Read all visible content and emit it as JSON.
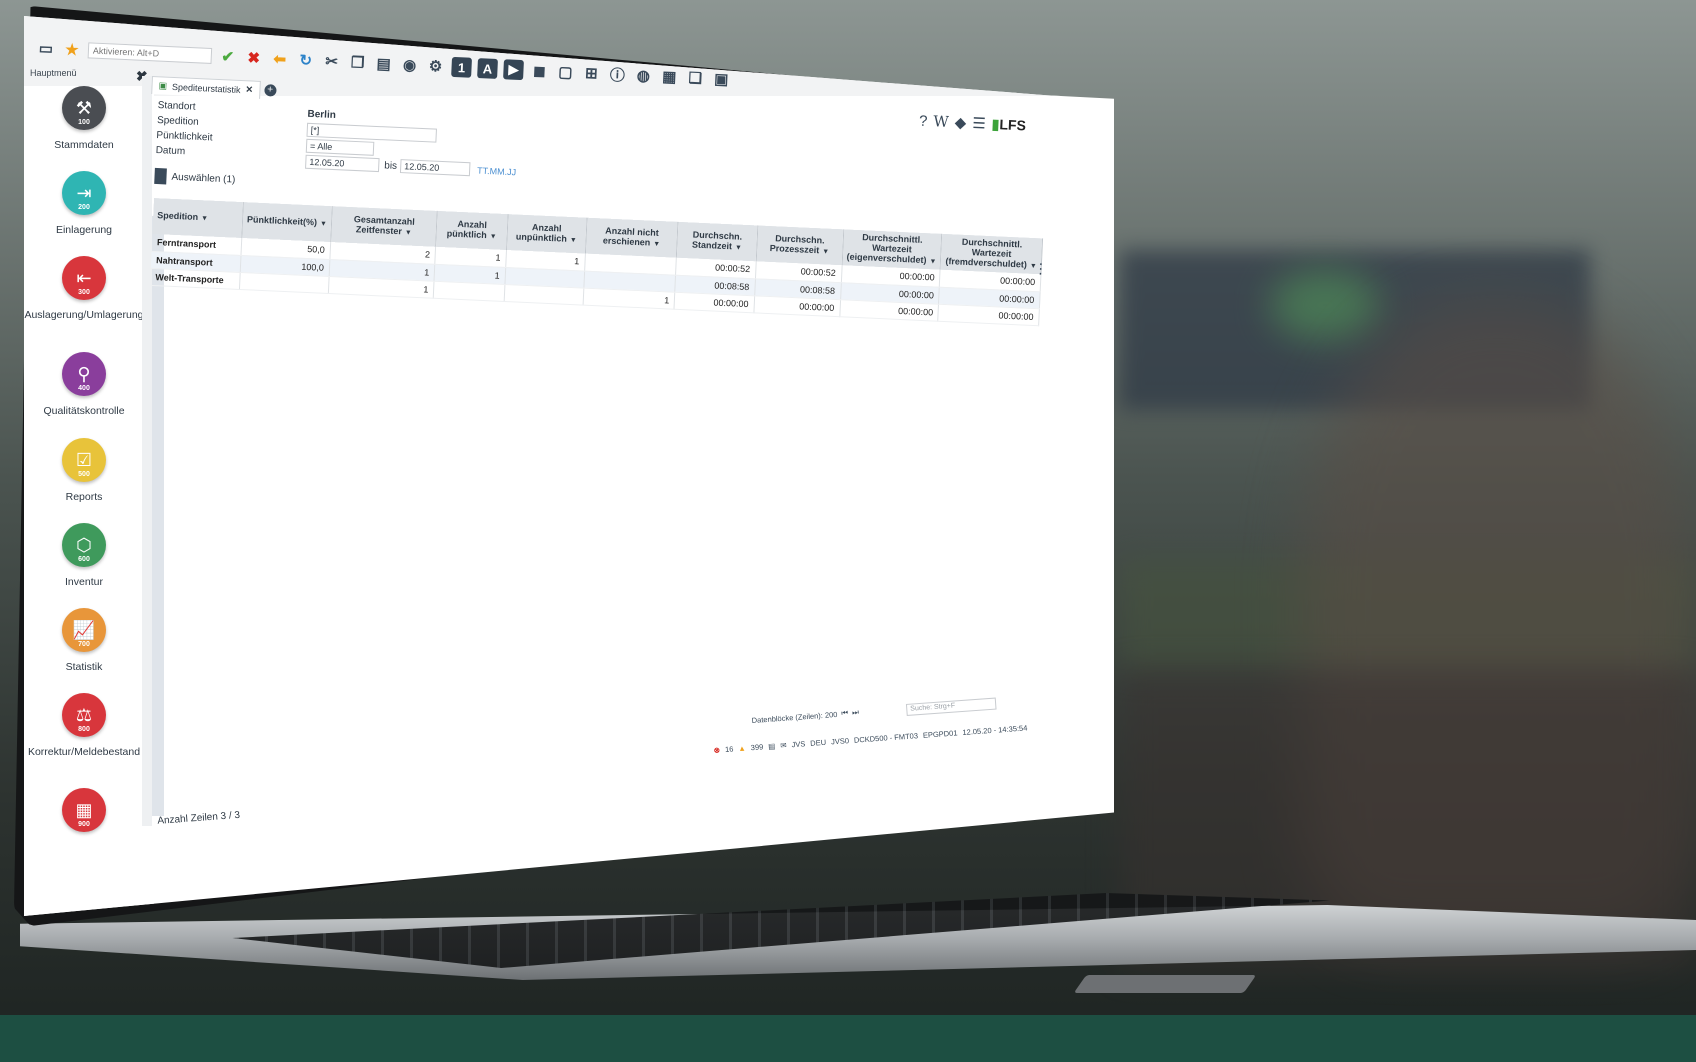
{
  "toolbar": {
    "activate_placeholder": "Aktivieren: Alt+D",
    "num_badge": "1",
    "letter_badge": "A"
  },
  "sidebar": {
    "title": "Hauptmenü",
    "items": [
      {
        "label": "Stammdaten",
        "num": "100",
        "color": "#4a4d52"
      },
      {
        "label": "Einlagerung",
        "num": "200",
        "color": "#2fb5b3"
      },
      {
        "label": "Auslagerung/Umlagerung",
        "num": "300",
        "color": "#d8363c"
      },
      {
        "label": "Qualitätskontrolle",
        "num": "400",
        "color": "#8a3e9c"
      },
      {
        "label": "Reports",
        "num": "500",
        "color": "#e8c33a"
      },
      {
        "label": "Inventur",
        "num": "600",
        "color": "#3f9a5c"
      },
      {
        "label": "Statistik",
        "num": "700",
        "color": "#e8963a"
      },
      {
        "label": "Korrektur/Meldebestand",
        "num": "800",
        "color": "#d8363c"
      },
      {
        "label": "",
        "num": "900",
        "color": "#d8363c"
      }
    ]
  },
  "tab": {
    "label": "Spediteurstatistik"
  },
  "filter": {
    "standort_label": "Standort",
    "spedition_label": "Spedition",
    "puenktlichkeit_label": "Pünktlichkeit",
    "datum_label": "Datum",
    "standort_value": "Berlin",
    "spedition_value": "[*]",
    "puenktlichkeit_value": "= Alle",
    "datum_from": "12.05.20",
    "datum_to_label": "bis",
    "datum_to": "12.05.20",
    "date_hint": "TT.MM.JJ",
    "auswaehlen_label": "Auswählen (1)"
  },
  "grid": {
    "columns": [
      "Spedition",
      "Pünktlichkeit(%)",
      "Gesamtanzahl Zeitfenster",
      "Anzahl pünktlich",
      "Anzahl unpünktlich",
      "Anzahl nicht erschienen",
      "Durchschn. Standzeit",
      "Durchschn. Prozesszeit",
      "Durchschnittl. Wartezeit (eigenverschuldet)",
      "Durchschnittl. Wartezeit (fremdverschuldet)"
    ],
    "rows": [
      [
        "Ferntransport",
        "50,0",
        "2",
        "1",
        "1",
        "",
        "00:00:52",
        "00:00:52",
        "00:00:00",
        "00:00:00"
      ],
      [
        "Nahtransport",
        "100,0",
        "1",
        "1",
        "",
        "",
        "00:08:58",
        "00:08:58",
        "00:00:00",
        "00:00:00"
      ],
      [
        "Welt-Transporte",
        "",
        "1",
        "",
        "",
        "1",
        "00:00:00",
        "00:00:00",
        "00:00:00",
        "00:00:00"
      ]
    ]
  },
  "footer": {
    "row_count": "Anzahl Zeilen 3 / 3",
    "datenbloecke": "Datenblöcke (Zeilen): 200",
    "search_placeholder": "Suche: Strg+F",
    "errors": "16",
    "warnings": "399",
    "status_segments": [
      "JVS",
      "DEU",
      "JVS0",
      "DCKD500 - FMT03",
      "EPGPD01",
      "12.05.20 - 14:35:54"
    ]
  }
}
